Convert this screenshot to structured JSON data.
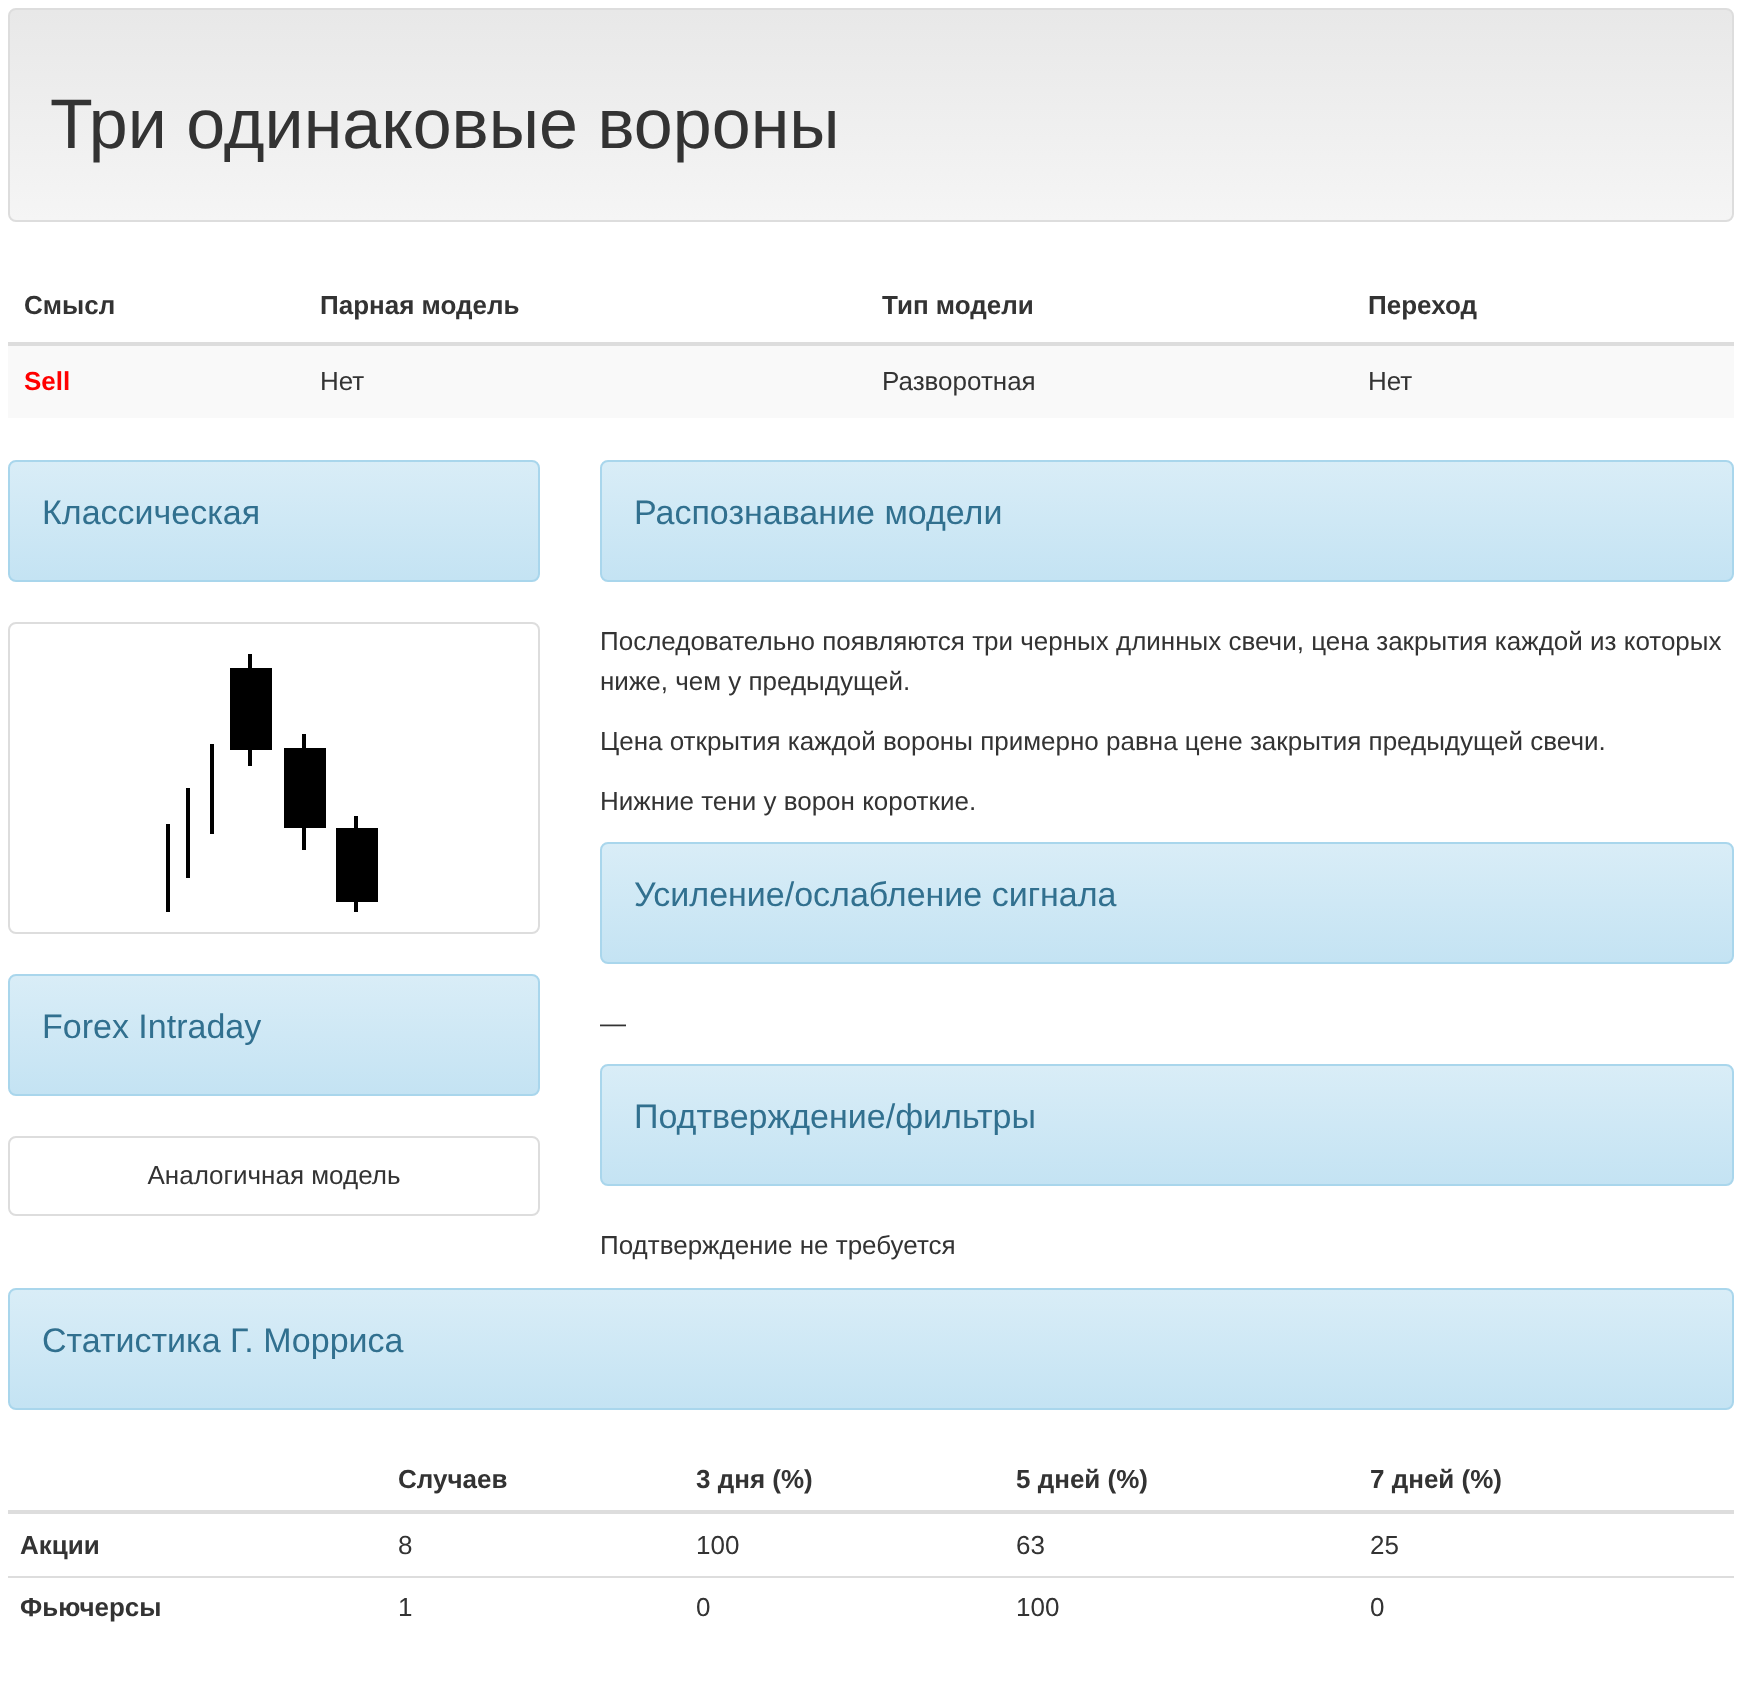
{
  "page_title": "Три одинаковые вороны",
  "summary": {
    "columns": [
      "Смысл",
      "Парная модель",
      "Тип модели",
      "Переход"
    ],
    "values": [
      {
        "text": "Sell",
        "kind": "signal"
      },
      {
        "text": "Нет",
        "kind": "plain"
      },
      {
        "text": "Разворотная",
        "kind": "plain"
      },
      {
        "text": "Нет",
        "kind": "plain"
      }
    ]
  },
  "left": {
    "classic_panel": "Классическая",
    "forex_panel": "Forex Intraday",
    "analog_link": "Аналогичная модель"
  },
  "sections": [
    {
      "title": "Распознавание модели",
      "paragraphs": [
        "Последовательно появляются три черных длинных свечи, цена закрытия каждой из которых ниже, чем у предыдущей.",
        "Цена открытия каждой вороны примерно равна цене закрытия предыдущей свечи.",
        "Нижние тени у ворон короткие."
      ]
    },
    {
      "title": "Усиление/ослабление сигнала",
      "paragraphs": [
        "—"
      ]
    },
    {
      "title": "Подтверждение/фильтры",
      "paragraphs": [
        "Подтверждение не требуется"
      ]
    }
  ],
  "stats": {
    "title": "Статистика Г. Морриса",
    "columns": [
      "Случаев",
      "3 дня (%)",
      "5 дней (%)",
      "7 дней (%)"
    ],
    "rows": [
      {
        "label": "Акции",
        "cells": [
          "8",
          "100",
          "63",
          "25"
        ]
      },
      {
        "label": "Фьючерсы",
        "cells": [
          "1",
          "0",
          "100",
          "0"
        ]
      }
    ]
  }
}
